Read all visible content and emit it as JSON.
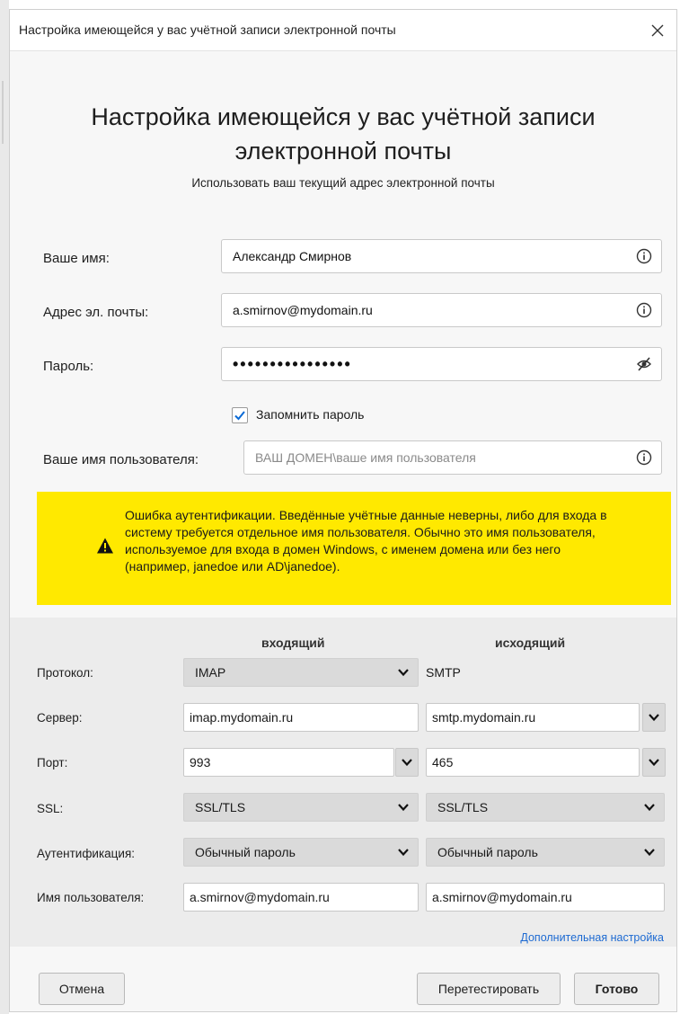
{
  "window": {
    "title": "Настройка имеющейся у вас учётной записи электронной почты"
  },
  "header": {
    "title": "Настройка имеющейся у вас учётной записи электронной почты",
    "subtitle": "Использовать ваш текущий адрес электронной почты"
  },
  "form": {
    "name_label": "Ваше имя:",
    "name_value": "Александр Смирнов",
    "email_label": "Адрес эл. почты:",
    "email_value": "a.smirnov@mydomain.ru",
    "password_label": "Пароль:",
    "password_value": "••••••••••••••••",
    "remember_label": "Запомнить пароль",
    "remember_checked": true,
    "username_label": "Ваше имя пользователя:",
    "username_placeholder": "ВАШ ДОМЕН\\ваше имя пользователя"
  },
  "warning": {
    "text": "Ошибка аутентификации. Введённые учётные данные неверны, либо для входа в систему требуется отдельное имя пользователя. Обычно это имя пользователя, используемое для входа в домен Windows, с именем домена или без него (например, janedoe или AD\\janedoe).",
    "color": "#ffe900"
  },
  "server_settings": {
    "incoming_header": "входящий",
    "outgoing_header": "исходящий",
    "protocol_label": "Протокол:",
    "incoming_protocol": "IMAP",
    "outgoing_protocol": "SMTP",
    "server_label": "Сервер:",
    "incoming_server": "imap.mydomain.ru",
    "outgoing_server": "smtp.mydomain.ru",
    "port_label": "Порт:",
    "incoming_port": "993",
    "outgoing_port": "465",
    "ssl_label": "SSL:",
    "incoming_ssl": "SSL/TLS",
    "outgoing_ssl": "SSL/TLS",
    "auth_label": "Аутентификация:",
    "incoming_auth": "Обычный пароль",
    "outgoing_auth": "Обычный пароль",
    "username_label": "Имя пользователя:",
    "incoming_username": "a.smirnov@mydomain.ru",
    "outgoing_username": "a.smirnov@mydomain.ru",
    "advanced_link": "Дополнительная настройка"
  },
  "buttons": {
    "cancel": "Отмена",
    "retest": "Перетестировать",
    "done": "Готово"
  },
  "colors": {
    "link": "#1d6ad2",
    "checkbox_accent": "#0a6ad6"
  }
}
